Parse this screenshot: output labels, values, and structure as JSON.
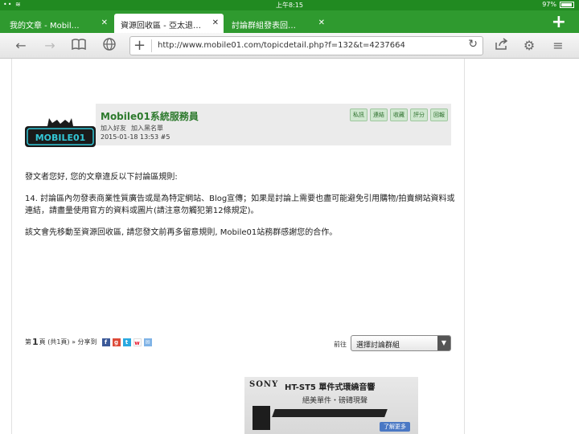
{
  "status": {
    "time": "上午8:15",
    "battery": "97%"
  },
  "tabs": [
    {
      "label": "我的文章 - Mobil…"
    },
    {
      "label": "資源回收區 - 亞太退…"
    },
    {
      "label": "討論群組發表回…"
    }
  ],
  "toolbar": {
    "url": "http://www.mobile01.com/topicdetail.php?f=132&t=4237664"
  },
  "post": {
    "username": "Mobile01系統服務員",
    "add_friend": "加入好友",
    "blacklist": "加入黑名單",
    "date": "2015-01-18 13:53",
    "post_no": "#5",
    "actions": [
      "私訊",
      "連結",
      "收藏",
      "評分",
      "回報"
    ],
    "paragraphs": [
      "發文者您好, 您的文章違反以下討論區規則:",
      "14. 討論區內勿發表商業性質廣告或是為特定網站、Blog宣傳；如果是討論上需要也盡可能避免引用購物/拍賣網站資料或連結，請盡量使用官方的資料或圖片(請注意勿觸犯第12條規定)。",
      "該文會先移動至資源回收區, 請您發文前再多留意規則, Mobile01站務群感謝您的合作。"
    ],
    "logo_text": "MOBILE01"
  },
  "pager": {
    "prefix": "第",
    "page": "1",
    "suffix": "頁 (共1頁) »",
    "share_label": "分享到"
  },
  "goto": {
    "label": "前往",
    "select_value": "選擇討論群組"
  },
  "ad": {
    "brand": "SONY",
    "model": "HT-ST5 單件式環繞音響",
    "tagline": "絕美單件・磅礡現聲",
    "more": "了解更多"
  },
  "colors": {
    "green": "#2f9a2f",
    "username": "#2d7a2d"
  }
}
